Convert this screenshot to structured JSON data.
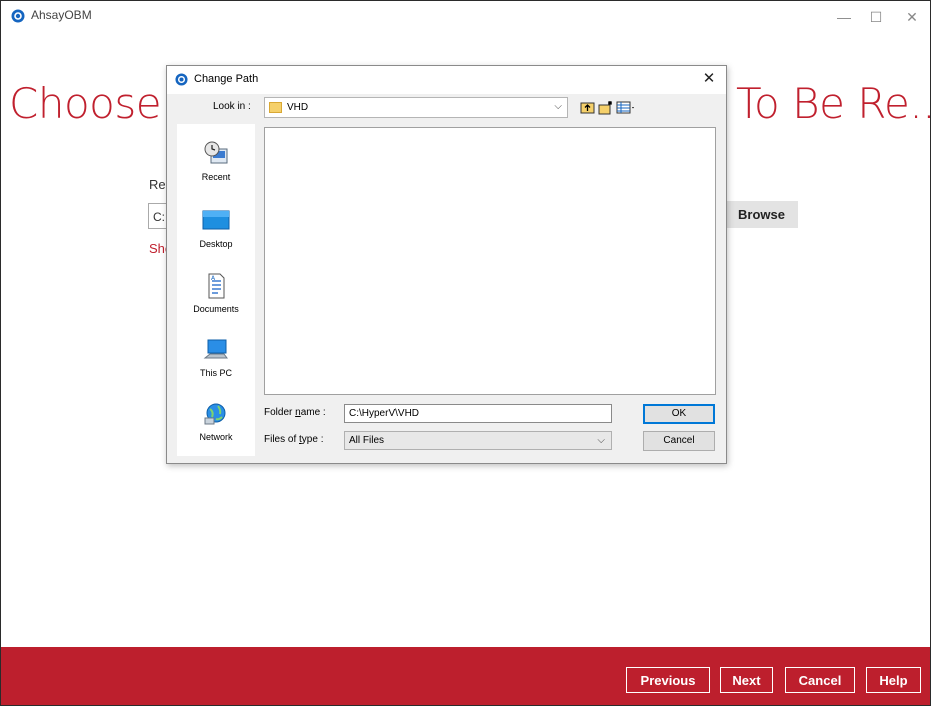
{
  "app": {
    "title": "AhsayOBM",
    "minimize": "—",
    "maximize": "☐",
    "close": "✕"
  },
  "page": {
    "heading_left": "Choose",
    "heading_right": "To Be Re..",
    "restore_label": "Res",
    "restore_value": "C:",
    "show_link": "Sho",
    "browse_label": "Browse"
  },
  "dialog": {
    "title": "Change Path",
    "close": "✕",
    "look_in_label": "Look in :",
    "look_in_value": "VHD",
    "toolbar": {
      "up_icon": "up-folder-icon",
      "new_folder_icon": "new-folder-icon",
      "view_icon": "view-menu-icon"
    },
    "places": [
      {
        "label": "Recent",
        "icon": "recent-icon"
      },
      {
        "label": "Desktop",
        "icon": "desktop-icon"
      },
      {
        "label": "Documents",
        "icon": "documents-icon"
      },
      {
        "label": "This PC",
        "icon": "this-pc-icon"
      },
      {
        "label": "Network",
        "icon": "network-icon"
      }
    ],
    "folder_name_label": "Folder name :",
    "folder_name_value": "C:\\HyperV\\VHD",
    "files_of_type_label": "Files of type :",
    "files_of_type_value": "All Files",
    "ok_label": "OK",
    "cancel_label": "Cancel"
  },
  "footer": {
    "previous_label": "Previous",
    "next_label": "Next",
    "cancel_label": "Cancel",
    "help_label": "Help"
  },
  "colors": {
    "brand": "#c0202e",
    "footer": "#bd1f2d",
    "dialog_bg": "#f0f0f0"
  }
}
